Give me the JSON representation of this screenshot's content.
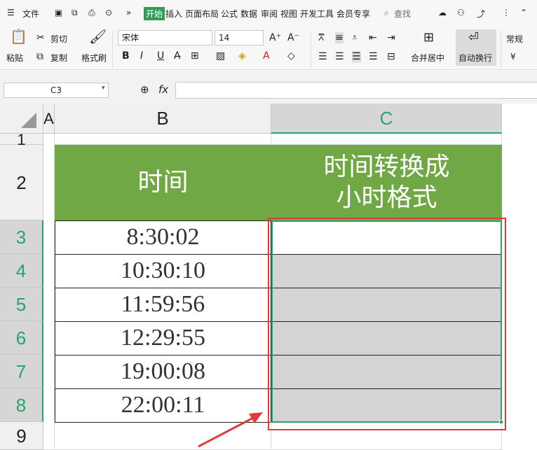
{
  "menu": {
    "file": "文件",
    "tabs": [
      "开始",
      "插入",
      "页面布局",
      "公式",
      "数据",
      "审阅",
      "视图",
      "开发工具",
      "会员专享"
    ],
    "search": "查找"
  },
  "ribbon": {
    "paste": "粘贴",
    "cut": "剪切",
    "copy": "复制",
    "format_painter": "格式刷",
    "font_name": "宋体",
    "font_size": "14",
    "merge_center": "合并居中",
    "wrap_text": "自动换行",
    "number_format": "常规",
    "currency_symbol": "¥"
  },
  "formula_bar": {
    "name_box": "C3",
    "fx": "fx",
    "content": ""
  },
  "sheet": {
    "columns": [
      "A",
      "B",
      "C"
    ],
    "rows": [
      "1",
      "2",
      "3",
      "4",
      "5",
      "6",
      "7",
      "8",
      "9"
    ],
    "header_b": "时间",
    "header_c_line1": "时间转换成",
    "header_c_line2": "小时格式",
    "times": [
      "8:30:02",
      "10:30:10",
      "11:59:56",
      "12:29:55",
      "19:00:08",
      "22:00:11"
    ]
  },
  "colors": {
    "header_green": "#71a846",
    "accent": "#2aa36b",
    "annotation_red": "#e03b3b"
  }
}
